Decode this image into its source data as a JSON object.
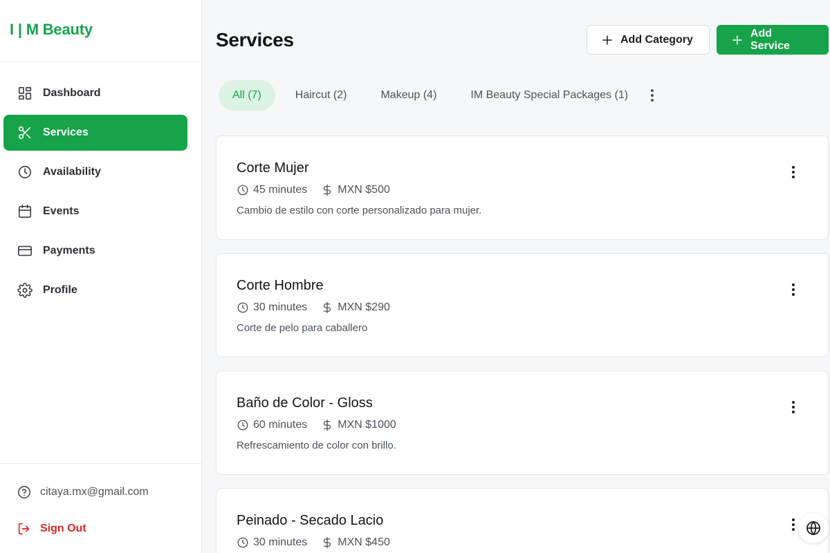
{
  "brand": {
    "name": "I | M Beauty",
    "color": "#16a34a"
  },
  "sidebar": {
    "items": [
      {
        "label": "Dashboard",
        "icon": "dashboard-grid-icon",
        "active": false
      },
      {
        "label": "Services",
        "icon": "scissors-icon",
        "active": true
      },
      {
        "label": "Availability",
        "icon": "clock-icon",
        "active": false
      },
      {
        "label": "Events",
        "icon": "calendar-icon",
        "active": false
      },
      {
        "label": "Payments",
        "icon": "credit-card-icon",
        "active": false
      },
      {
        "label": "Profile",
        "icon": "gear-icon",
        "active": false
      }
    ],
    "footer": {
      "email": "citaya.mx@gmail.com",
      "sign_out": "Sign Out"
    }
  },
  "header": {
    "title": "Services",
    "add_category": "Add Category",
    "add_service": "Add Service"
  },
  "tabs": [
    {
      "label": "All (7)",
      "active": true
    },
    {
      "label": "Haircut (2)",
      "active": false
    },
    {
      "label": "Makeup (4)",
      "active": false
    },
    {
      "label": "IM Beauty Special Packages (1)",
      "active": false
    }
  ],
  "services": [
    {
      "name": "Corte Mujer",
      "duration": "45 minutes",
      "price": "MXN $500",
      "description": "Cambio de estilo con corte personalizado para mujer."
    },
    {
      "name": "Corte Hombre",
      "duration": "30 minutes",
      "price": "MXN $290",
      "description": "Corte de pelo para caballero"
    },
    {
      "name": "Baño de Color - Gloss",
      "duration": "60 minutes",
      "price": "MXN $1000",
      "description": "Refrescamiento de color con brillo."
    },
    {
      "name": "Peinado - Secado Lacio",
      "duration": "30 minutes",
      "price": "MXN $450",
      "description": ""
    }
  ],
  "colors": {
    "accent": "#16a34a",
    "accent_light": "#dcf2e3",
    "danger": "#dc2626",
    "background": "#f6f7f9"
  }
}
